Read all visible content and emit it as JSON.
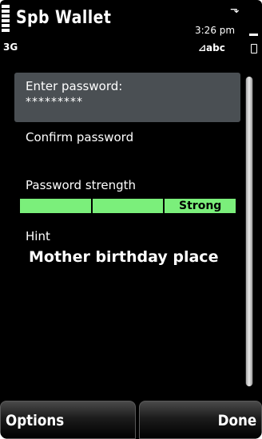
{
  "status": {
    "app_title": "Spb Wallet",
    "network": "3G",
    "time": "3:26 pm",
    "input_mode": "⊿abc",
    "usb_icon": "⬎"
  },
  "form": {
    "password_label": "Enter password:",
    "password_value": "*********",
    "confirm_label": "Confirm password",
    "strength_label": "Password strength",
    "strength_value": "Strong",
    "strength_segments_filled": 3,
    "strength_color": "#7bef7b",
    "hint_label": "Hint",
    "hint_value": "Mother birthday place"
  },
  "softkeys": {
    "left": "Options",
    "right": "Done"
  }
}
